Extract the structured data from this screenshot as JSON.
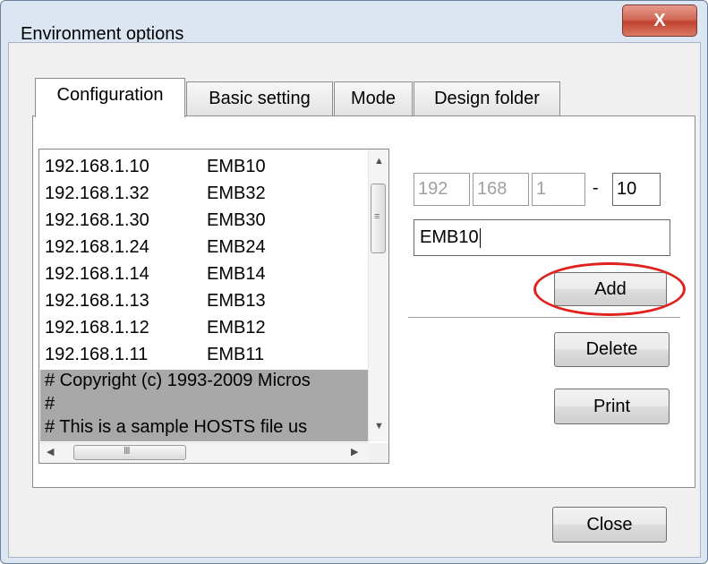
{
  "window": {
    "title": "Environment options",
    "close_glyph": "X"
  },
  "tabs": [
    {
      "label": "Configuration",
      "active": true
    },
    {
      "label": "Basic setting",
      "active": false
    },
    {
      "label": "Mode",
      "active": false
    },
    {
      "label": "Design folder",
      "active": false
    }
  ],
  "host_list": {
    "items": [
      {
        "ip": "192.168.1.10",
        "name": "EMB10"
      },
      {
        "ip": "192.168.1.32",
        "name": "EMB32"
      },
      {
        "ip": "192.168.1.30",
        "name": "EMB30"
      },
      {
        "ip": "192.168.1.24",
        "name": "EMB24"
      },
      {
        "ip": "192.168.1.14",
        "name": "EMB14"
      },
      {
        "ip": "192.168.1.13",
        "name": "EMB13"
      },
      {
        "ip": "192.168.1.12",
        "name": "EMB12"
      },
      {
        "ip": "192.168.1.11",
        "name": "EMB11"
      }
    ],
    "comment_lines": [
      "# Copyright (c) 1993-2009 Micros",
      "#",
      "# This is a sample HOSTS file us"
    ]
  },
  "ip_input": {
    "octet1": "192",
    "octet2": "168",
    "octet3": "1",
    "separator": "-",
    "octet4": "10"
  },
  "name_input": {
    "value": "EMB10"
  },
  "buttons": {
    "add": "Add",
    "delete": "Delete",
    "print": "Print",
    "close": "Close"
  },
  "colors": {
    "highlight": "#e0221f",
    "selected_bg": "#a8a8a8",
    "close_button": "#c0432f"
  }
}
